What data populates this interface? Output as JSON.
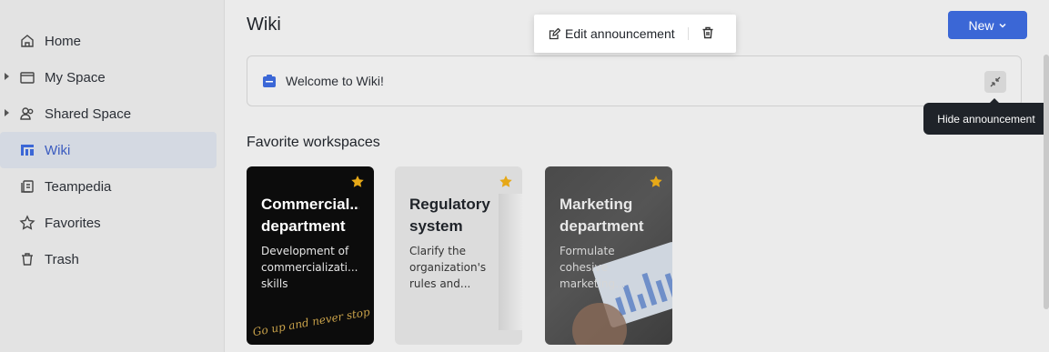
{
  "sidebar": {
    "items": [
      {
        "label": "Home",
        "icon": "home-icon"
      },
      {
        "label": "My Space",
        "icon": "folder-icon"
      },
      {
        "label": "Shared Space",
        "icon": "users-icon"
      },
      {
        "label": "Wiki",
        "icon": "wiki-icon"
      },
      {
        "label": "Teampedia",
        "icon": "teampedia-icon"
      },
      {
        "label": "Favorites",
        "icon": "star-icon"
      },
      {
        "label": "Trash",
        "icon": "trash-icon"
      }
    ]
  },
  "header": {
    "title": "Wiki",
    "new_label": "New"
  },
  "announcement": {
    "text": "Welcome to Wiki!",
    "edit_label": "Edit announcement",
    "hide_tooltip": "Hide announcement"
  },
  "favorites": {
    "title": "Favorite workspaces",
    "cards": [
      {
        "title": "Commercial... department",
        "title_l1": "Commercial...",
        "title_l2": "department",
        "desc_l1": "Development of",
        "desc_l2": "commercializati...",
        "desc_l3": "skills",
        "art_text": "Go up and never stop"
      },
      {
        "title": "Regulatory system",
        "title_l1": "Regulatory",
        "title_l2": "system",
        "desc_l1": "Clarify the",
        "desc_l2": "organization's",
        "desc_l3": "rules and..."
      },
      {
        "title": "Marketing department",
        "title_l1": "Marketing",
        "title_l2": "department",
        "desc_l1": "Formulate",
        "desc_l2": "cohesive",
        "desc_l3": "marketing..."
      }
    ]
  },
  "colors": {
    "accent": "#3b67d6",
    "star": "#e6a817",
    "tooltip_bg": "#1f2329"
  }
}
